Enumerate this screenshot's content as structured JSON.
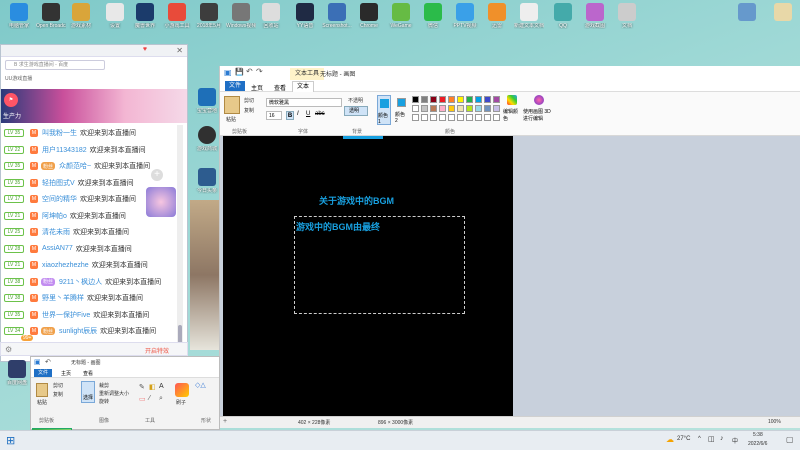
{
  "desktop": {
    "top_icons": [
      "电脑管家",
      "Open Broadcast...",
      "游戏素材",
      "设置",
      "魔兽世界",
      "小游戏工具",
      "2018年5月",
      "Windows视频",
      "回收站",
      "YY语音",
      "Screenshot...",
      "Chrome",
      "WeGame",
      "微信",
      "PPTV视频",
      "迅雷",
      "新建文本文档",
      "QQ",
      "游戏截图",
      "文档"
    ],
    "side_icons": [
      "宝宝营地",
      "游戏商城",
      "今日头条"
    ],
    "bottom_icon": "百度网盘"
  },
  "chat": {
    "address": "B 求生游戏直播间 - 百度",
    "tab_label": "UU游戏直播",
    "banner_label": "生产力",
    "rows": [
      {
        "lv": "LV 35",
        "badge": "",
        "name": "叫我粉一生",
        "msg": "欢迎来到本直播间"
      },
      {
        "lv": "LV 22",
        "badge": "",
        "name": "用户11343182",
        "msg": "欢迎来到本直播间"
      },
      {
        "lv": "LV 35",
        "badge": "粉丝",
        "badge_color": "orange",
        "name": "众颜范哈~",
        "msg": "欢迎来到本直播间"
      },
      {
        "lv": "LV 35",
        "badge": "",
        "name": "轻拍图式V",
        "msg": "欢迎来到本直播间"
      },
      {
        "lv": "LV 17",
        "badge": "",
        "name": "空间的精华",
        "msg": "欢迎来到本直播间"
      },
      {
        "lv": "LV 21",
        "badge": "",
        "name": "阿坤帕o",
        "msg": "欢迎来到本直播间"
      },
      {
        "lv": "LV 25",
        "badge": "",
        "name": "清花未雨",
        "msg": "欢迎来到本直播间"
      },
      {
        "lv": "LV 28",
        "badge": "",
        "name": "AssiAN77",
        "msg": "欢迎来到本直播间"
      },
      {
        "lv": "LV 21",
        "badge": "",
        "name": "xiaozhezhezhe",
        "msg": "欢迎来到本直播间"
      },
      {
        "lv": "LV 38",
        "badge": "粉丝",
        "badge_color": "purple",
        "name": "9211丶枫边人",
        "msg": "欢迎来到本直播间"
      },
      {
        "lv": "LV 38",
        "badge": "",
        "name": "野里丶羊腾样",
        "msg": "欢迎来到本直播间"
      },
      {
        "lv": "LV 35",
        "badge": "",
        "name": "世界一保护Five",
        "msg": "欢迎来到本直播间"
      },
      {
        "lv": "LV 34",
        "badge": "粉丝",
        "badge_color": "orange",
        "name": "sunlight辰辰",
        "msg": "欢迎来到本直播间"
      }
    ],
    "ml_label": "M",
    "bottom_bar": "开启特效",
    "count": "99+"
  },
  "paint": {
    "title": "无标题 - 画图",
    "context_tab": "文本工具",
    "tabs": [
      "文件",
      "主页",
      "查看",
      "文本"
    ],
    "font_name": "微软雅黑",
    "font_size": "16",
    "clipboard": "剪贴板",
    "font_group": "字体",
    "background_group": "背景",
    "color_group": "颜色",
    "opaque": "不透明",
    "transparent": "透明",
    "paste": "粘贴",
    "cut": "剪切",
    "copy": "复制",
    "color1": "颜色 1",
    "color2": "颜色 2",
    "edit_colors": "编辑颜色",
    "paint3d": "使用画图 3D 进行编辑",
    "palette": [
      "#000000",
      "#7f7f7f",
      "#880015",
      "#ed1c24",
      "#ff7f27",
      "#fff200",
      "#22b14c",
      "#00a2e8",
      "#3f48cc",
      "#a349a4",
      "#ffffff",
      "#c3c3c3",
      "#b97a57",
      "#ffaec9",
      "#ffc90e",
      "#efe4b0",
      "#b5e61d",
      "#99d9ea",
      "#7092be",
      "#c8bfe7"
    ],
    "canvas_text_1": "关于游戏中的BGM",
    "canvas_text_2": "游戏中的BGM由最终",
    "status_selection": "402 × 228像素",
    "status_size": "896 × 3000像素",
    "zoom": "100%"
  },
  "small_paint": {
    "title": "无标题 - 画图",
    "tabs": [
      "文件",
      "主页",
      "查看"
    ],
    "paste": "粘贴",
    "cut": "剪切",
    "copy": "复制",
    "crop": "裁剪",
    "resize": "重新调整大小",
    "rotate": "旋转",
    "select": "选择",
    "clipboard": "剪贴板",
    "image": "图像",
    "tools": "工具",
    "brushes": "刷子",
    "shapes": "形状"
  },
  "taskbar": {
    "temp": "27°C",
    "time": "5:38",
    "date": "2022/6/6",
    "lang": "中"
  }
}
